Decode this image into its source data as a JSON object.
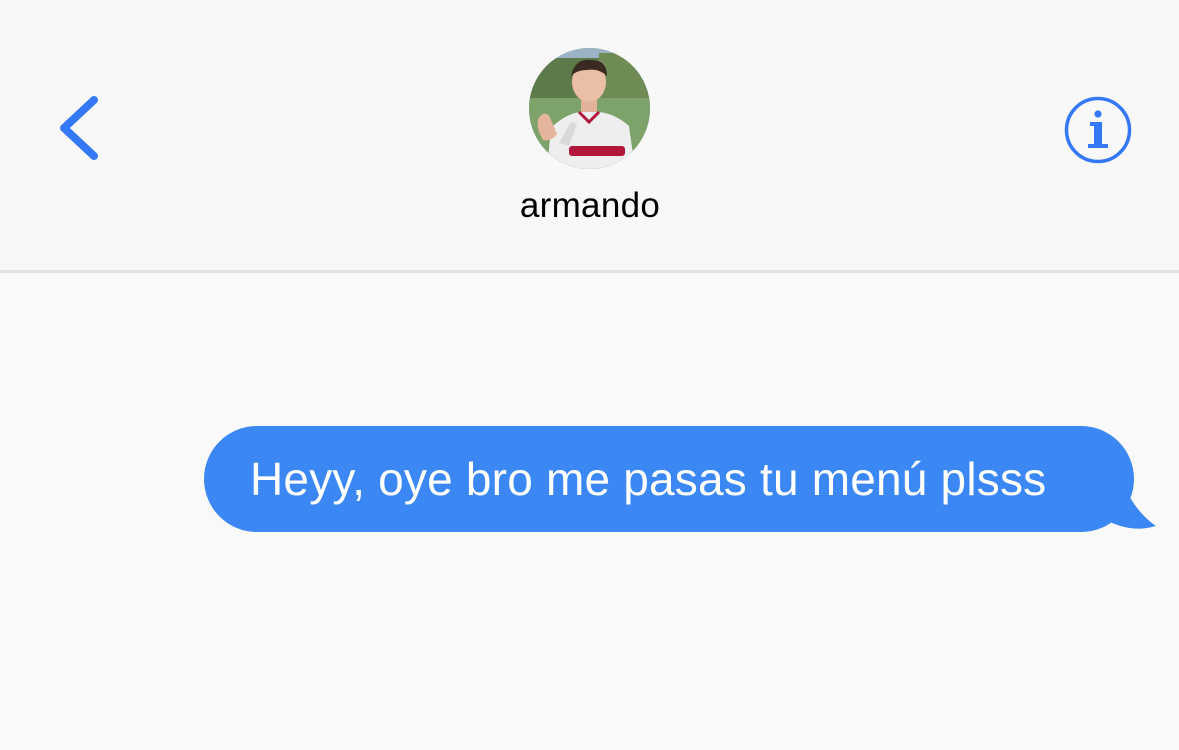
{
  "header": {
    "back_icon": "chevron-left-icon",
    "info_icon": "info-circle-icon",
    "contact": {
      "name": "armando",
      "avatar": "contact-photo"
    }
  },
  "conversation": {
    "messages": [
      {
        "direction": "outgoing",
        "text": "Heyy, oye bro me pasas tu menú plsss"
      }
    ]
  },
  "colors": {
    "accent": "#3478f6",
    "bubble": "#3b87f4",
    "background": "#f9f9f9",
    "divider": "#e3e3e6"
  }
}
